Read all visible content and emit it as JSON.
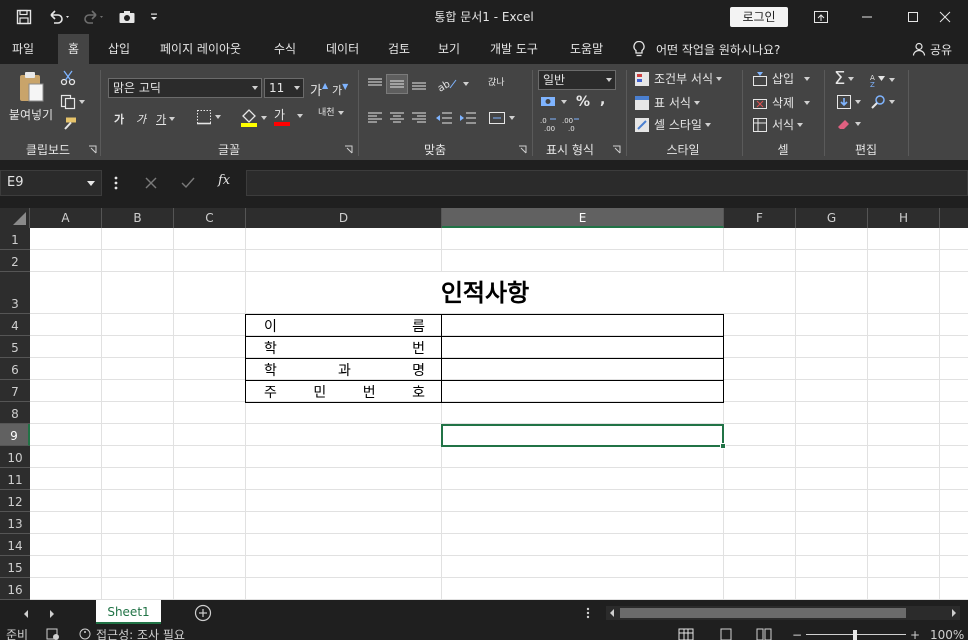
{
  "window": {
    "title": "통합 문서1  -  Excel",
    "login_label": "로그인"
  },
  "tabs": [
    {
      "label": "파일"
    },
    {
      "label": "홈",
      "active": true
    },
    {
      "label": "삽입"
    },
    {
      "label": "페이지 레이아웃"
    },
    {
      "label": "수식"
    },
    {
      "label": "데이터"
    },
    {
      "label": "검토"
    },
    {
      "label": "보기"
    },
    {
      "label": "개발 도구"
    },
    {
      "label": "도움말"
    }
  ],
  "tell_me": "어떤 작업을 원하시나요?",
  "share_label": "공유",
  "ribbon": {
    "clipboard": {
      "label": "클립보드",
      "paste_label": "붙여넣기"
    },
    "font": {
      "label": "글꼴",
      "font_name": "맑은 고딕",
      "font_size": "11",
      "grow": "가",
      "shrink": "가",
      "bold": "가",
      "italic": "가",
      "underline": "가",
      "font_color_glyph": "가",
      "phonetic": "내천"
    },
    "alignment": {
      "label": "맞춤",
      "wrap_glyph": "갅나"
    },
    "number": {
      "label": "표시 형식",
      "format": "일반",
      "percent": "%",
      "comma": ","
    },
    "styles": {
      "label": "스타일",
      "conditional": "조건부 서식",
      "table": "표 서식",
      "cell_styles": "셀 스타일"
    },
    "cells": {
      "label": "셀",
      "insert": "삽입",
      "delete": "삭제",
      "format": "서식"
    },
    "editing": {
      "label": "편집",
      "sum_glyph": "Σ"
    }
  },
  "formula_bar": {
    "name_box": "E9",
    "fx": "fx",
    "value": ""
  },
  "grid": {
    "columns": [
      "A",
      "B",
      "C",
      "D",
      "E",
      "F",
      "G",
      "H"
    ],
    "rows": [
      "1",
      "2",
      "3",
      "4",
      "5",
      "6",
      "7",
      "8",
      "9",
      "10",
      "11",
      "12",
      "13",
      "14",
      "15",
      "16"
    ],
    "selected_column": "E",
    "selected_row": "9",
    "title": "인적사항",
    "table_rows": [
      {
        "chars": [
          "이",
          "름"
        ]
      },
      {
        "chars": [
          "학",
          "번"
        ]
      },
      {
        "chars": [
          "학",
          "과",
          "명"
        ]
      },
      {
        "chars": [
          "주",
          "민",
          "번",
          "호"
        ]
      }
    ]
  },
  "sheet_tab": "Sheet1",
  "status": {
    "ready": "준비",
    "accessibility": "접근성: 조사 필요",
    "zoom": "100%"
  },
  "colors": {
    "accent": "#217346",
    "chrome": "#1f1f1f",
    "ribbon": "#444444"
  }
}
